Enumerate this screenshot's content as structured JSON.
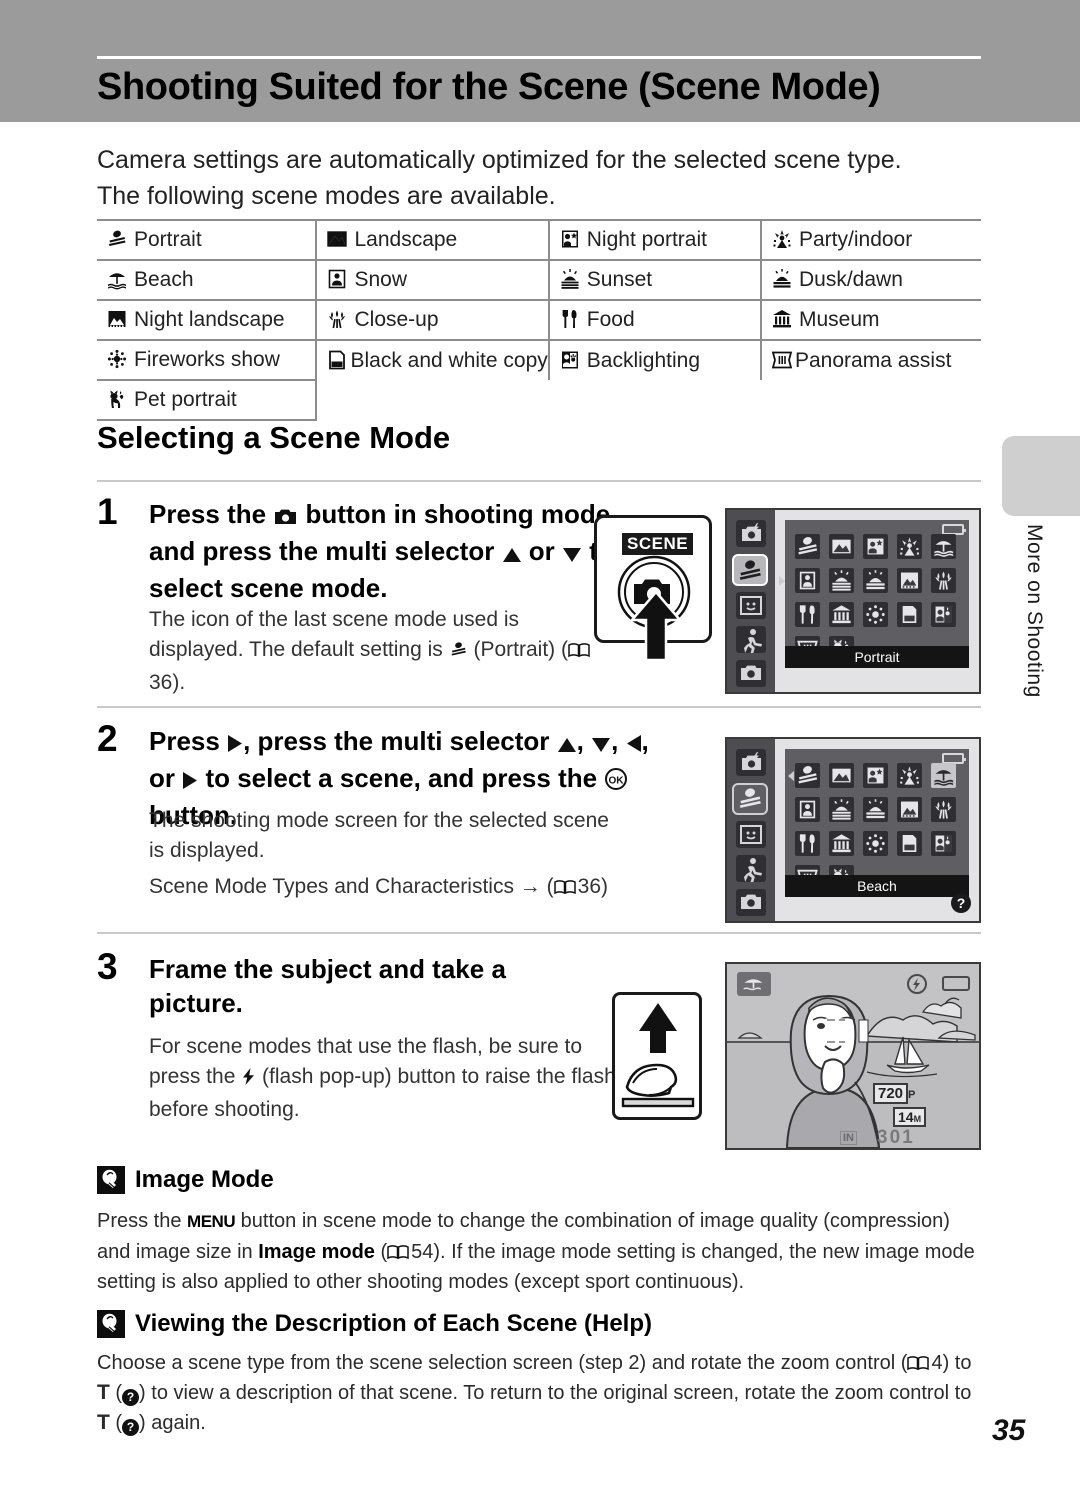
{
  "header": {
    "title": "Shooting Suited for the Scene (Scene Mode)",
    "band_color": "#9b9b9b"
  },
  "intro": "Camera settings are automatically optimized for the selected scene type. The following scene modes are available.",
  "scene_table": {
    "rows": [
      [
        {
          "icon": "portrait-icon",
          "label": "Portrait"
        },
        {
          "icon": "landscape-icon",
          "label": "Landscape"
        },
        {
          "icon": "night-portrait-icon",
          "label": "Night portrait"
        },
        {
          "icon": "party-indoor-icon",
          "label": "Party/indoor"
        }
      ],
      [
        {
          "icon": "beach-icon",
          "label": "Beach"
        },
        {
          "icon": "snow-icon",
          "label": "Snow"
        },
        {
          "icon": "sunset-icon",
          "label": "Sunset"
        },
        {
          "icon": "dusk-dawn-icon",
          "label": "Dusk/dawn"
        }
      ],
      [
        {
          "icon": "night-landscape-icon",
          "label": "Night landscape"
        },
        {
          "icon": "close-up-icon",
          "label": "Close-up"
        },
        {
          "icon": "food-icon",
          "label": "Food"
        },
        {
          "icon": "museum-icon",
          "label": "Museum"
        }
      ],
      [
        {
          "icon": "fireworks-icon",
          "label": "Fireworks show"
        },
        {
          "icon": "bw-copy-icon",
          "label": "Black and white copy"
        },
        {
          "icon": "backlighting-icon",
          "label": "Backlighting"
        },
        {
          "icon": "panorama-assist-icon",
          "label": "Panorama assist"
        }
      ],
      [
        {
          "icon": "pet-portrait-icon",
          "label": "Pet portrait"
        }
      ]
    ]
  },
  "subhead": "Selecting a Scene Mode",
  "steps": [
    {
      "number": "1",
      "heading_parts": {
        "a": "Press the ",
        "b": " button in shooting mode and press the multi selector ",
        "c": " or ",
        "d": " to select scene mode."
      },
      "body_a": "The icon of the last scene mode used is displayed. The default setting is ",
      "body_b": " (Portrait) (",
      "body_page": "36",
      "body_c": ")."
    },
    {
      "number": "2",
      "heading_parts": {
        "a": "Press ",
        "b": ", press the multi selector ",
        "c": ", ",
        "d": ", ",
        "e": ", or ",
        "f": " to select a scene, and press the ",
        "g": " button."
      },
      "body_a": "The shooting mode screen for the selected scene is displayed.",
      "body_b": "Scene Mode Types and Characteristics → (",
      "body_page": "36",
      "body_c": ")"
    },
    {
      "number": "3",
      "heading": "Frame the subject and take a picture.",
      "body_a": "For scene modes that use the flash, be sure to press the ",
      "body_b": " (flash pop-up) button to raise the flash before shooting."
    }
  ],
  "illustrations": {
    "scene_button_label": "SCENE",
    "screen1": {
      "caption": "Portrait",
      "sidebar_icons": [
        "auto-flash-mode-icon",
        "scene-mode-icon",
        "smart-portrait-mode-icon",
        "sport-mode-icon",
        "auto-mode-icon"
      ],
      "selected_sidebar_index": 1,
      "grid_icons": [
        "portrait-icon",
        "landscape-icon",
        "night-portrait-icon",
        "party-indoor-icon",
        "beach-icon",
        "snow-icon",
        "sunset-icon",
        "dusk-dawn-icon",
        "night-landscape-icon",
        "close-up-icon",
        "food-icon",
        "museum-icon",
        "fireworks-icon",
        "bw-copy-icon",
        "backlighting-icon",
        "panorama-assist-icon",
        "pet-portrait-icon"
      ],
      "highlighted_grid_index": -1
    },
    "screen2": {
      "caption": "Beach",
      "sidebar_icons": [
        "auto-flash-mode-icon",
        "scene-mode-icon",
        "smart-portrait-mode-icon",
        "sport-mode-icon",
        "auto-mode-icon"
      ],
      "selected_sidebar_index": 1,
      "grid_icons": [
        "portrait-icon",
        "landscape-icon",
        "night-portrait-icon",
        "party-indoor-icon",
        "beach-icon",
        "snow-icon",
        "sunset-icon",
        "dusk-dawn-icon",
        "night-landscape-icon",
        "close-up-icon",
        "food-icon",
        "museum-icon",
        "fireworks-icon",
        "bw-copy-icon",
        "backlighting-icon",
        "panorama-assist-icon",
        "pet-portrait-icon"
      ],
      "highlighted_grid_index": 4,
      "help_badge": "?"
    },
    "photo_screen": {
      "movie_mode": "720",
      "movie_mode_suffix": "P",
      "image_size": "14",
      "image_size_suffix": "M",
      "memory_indicator": "IN",
      "shots_remaining": "301"
    }
  },
  "notes": [
    {
      "icon": "lightbulb-note-icon",
      "title": "Image Mode",
      "body_a": "Press the ",
      "menu_label": "MENU",
      "body_b": " button in scene mode to change the combination of image quality (compression) and image size in ",
      "bold_term": "Image mode",
      "body_c": " (",
      "page_ref": "54",
      "body_d": "). If the image mode setting is changed, the new image mode setting is also applied to other shooting modes (except sport continuous)."
    },
    {
      "icon": "lightbulb-note-icon",
      "title": "Viewing the Description of Each Scene (Help)",
      "body_a": "Choose a scene type from the scene selection screen (step 2) and rotate the zoom control (",
      "page_ref": "4",
      "body_b": ") to ",
      "t_label": "T",
      "body_c": " (",
      "q_label": "?",
      "body_d": ") to view a description of that scene. To return to the original screen, rotate the zoom control to ",
      "t_label2": "T",
      "body_e": " (",
      "q_label2": "?",
      "body_f": ") again."
    }
  ],
  "side_tab": {
    "text": "More on Shooting",
    "color": "#cfcfcf"
  },
  "page_number": "35"
}
